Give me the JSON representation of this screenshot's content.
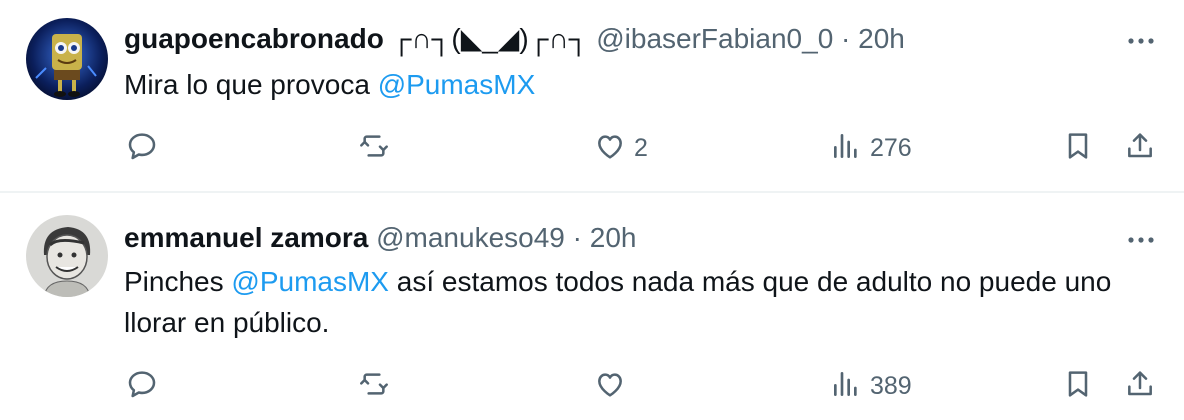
{
  "tweets": [
    {
      "display_name": "guapoencabronado",
      "name_decoration": "┌∩┐(◣_◢)┌∩┐",
      "handle": "@ibaserFabian0_0",
      "separator": "·",
      "time": "20h",
      "text_before": "Mira lo que provoca ",
      "mention": "@PumasMX",
      "text_after": "",
      "reply_count": "",
      "retweet_count": "",
      "like_count": "2",
      "view_count": "276"
    },
    {
      "display_name": "emmanuel zamora",
      "name_decoration": "",
      "handle": "@manukeso49",
      "separator": "·",
      "time": "20h",
      "text_before": "Pinches ",
      "mention": "@PumasMX",
      "text_after": " así estamos todos nada más que de adulto no puede uno llorar en público.",
      "reply_count": "",
      "retweet_count": "",
      "like_count": "",
      "view_count": "389"
    }
  ],
  "icons": {
    "reply": "reply-icon",
    "retweet": "retweet-icon",
    "like": "heart-icon",
    "views": "views-icon",
    "bookmark": "bookmark-icon",
    "share": "share-icon",
    "more": "more-icon"
  },
  "colors": {
    "text": "#0f1419",
    "secondary": "#536471",
    "link": "#1d9bf0",
    "divider": "#eff3f4"
  }
}
